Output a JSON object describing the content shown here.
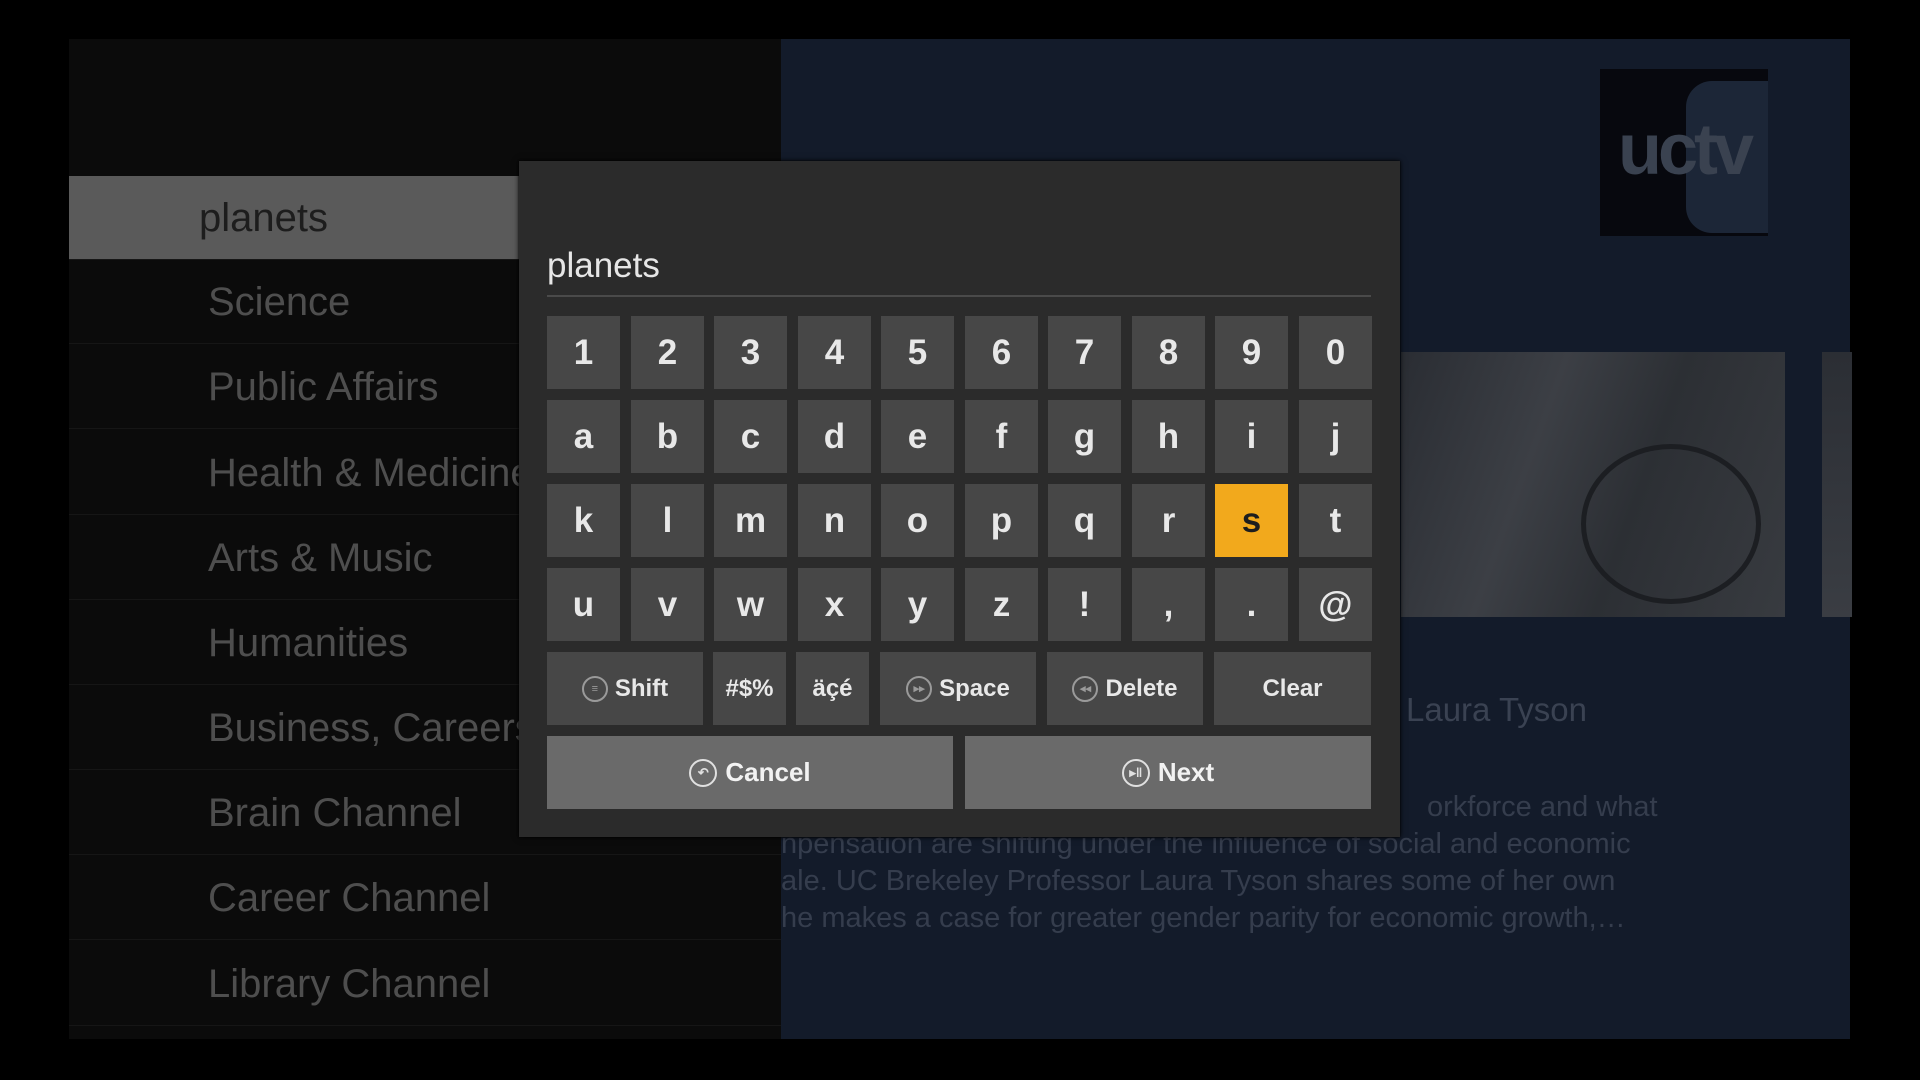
{
  "sidebar": {
    "items": [
      {
        "label": "planets"
      },
      {
        "label": "Science"
      },
      {
        "label": "Public Affairs"
      },
      {
        "label": "Health & Medicine"
      },
      {
        "label": "Arts & Music"
      },
      {
        "label": "Humanities"
      },
      {
        "label": "Business, Careers"
      },
      {
        "label": "Brain Channel"
      },
      {
        "label": "Career Channel"
      },
      {
        "label": "Library Channel"
      }
    ],
    "selected_index": 0
  },
  "detail": {
    "logo_text": "uctv",
    "presenter": "Laura Tyson",
    "description_lines": [
      "orkforce and what",
      "npensation are shifting under the influence of social and economic",
      "ale. UC Brekeley Professor Laura Tyson shares some of her own",
      "he makes a case for greater gender parity for economic growth,…"
    ]
  },
  "keyboard": {
    "input_value": "planets",
    "rows": [
      [
        "1",
        "2",
        "3",
        "4",
        "5",
        "6",
        "7",
        "8",
        "9",
        "0"
      ],
      [
        "a",
        "b",
        "c",
        "d",
        "e",
        "f",
        "g",
        "h",
        "i",
        "j"
      ],
      [
        "k",
        "l",
        "m",
        "n",
        "o",
        "p",
        "q",
        "r",
        "s",
        "t"
      ],
      [
        "u",
        "v",
        "w",
        "x",
        "y",
        "z",
        "!",
        ",",
        ".",
        "@"
      ]
    ],
    "highlighted_key": "s",
    "function_keys": {
      "shift": "Shift",
      "symbols": "#$%",
      "accents": "äçé",
      "space": "Space",
      "delete": "Delete",
      "clear": "Clear"
    },
    "actions": {
      "cancel": "Cancel",
      "next": "Next"
    },
    "icons": {
      "shift": "menu-icon",
      "space": "fast-forward-icon",
      "delete": "rewind-icon",
      "cancel": "back-icon",
      "next": "play-pause-icon"
    },
    "highlight_color": "#f2a91c"
  }
}
